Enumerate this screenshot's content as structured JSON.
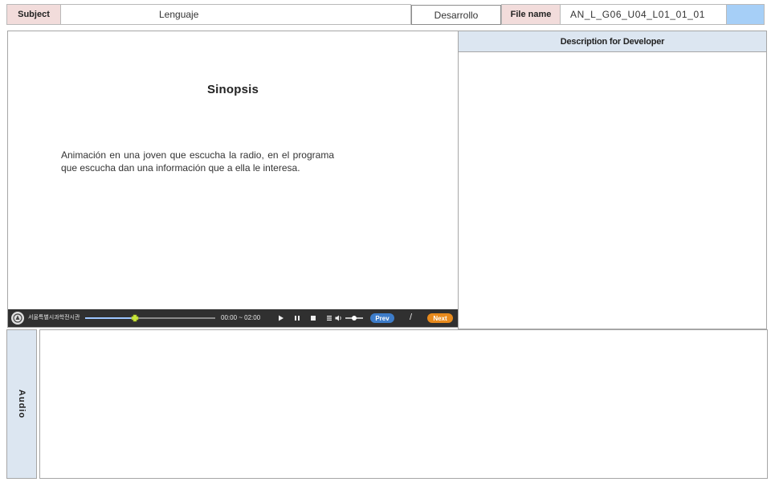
{
  "header": {
    "subject_label": "Subject",
    "subject_value": "Lenguaje",
    "category_value": "Desarrollo",
    "file_label": "File name",
    "file_value": "AN_L_G06_U04_L01_01_01",
    "swatch_color": "#a6cff7"
  },
  "preview": {
    "title": "Sinopsis",
    "body": "Animación en  una joven que escucha la radio, en el programa que escucha dan una información que a ella le interesa."
  },
  "player": {
    "logo_text": "서울특별시과학전시관",
    "logo_icon": "emblem-icon",
    "progress": 0.38,
    "time": "00:00 ~ 02:00",
    "controls": [
      "play-icon",
      "pause-icon",
      "stop-icon",
      "menu-icon",
      "volume-icon"
    ],
    "volume": 0.5,
    "prev_label": "Prev",
    "separator": "/",
    "next_label": "Next",
    "track_color": "#9ec6ff",
    "knob_color": "#c8e63c"
  },
  "description": {
    "header": "Description for Developer"
  },
  "audio": {
    "label": "Audio"
  }
}
